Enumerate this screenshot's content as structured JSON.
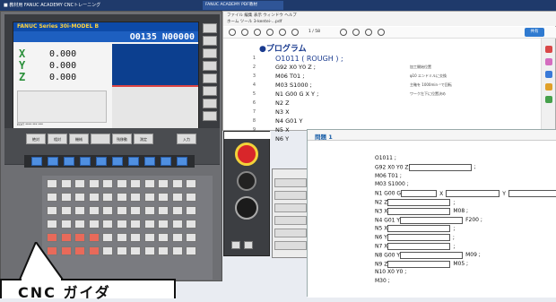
{
  "titlebar": {
    "text": "■ 教材用 FANUC ACADEMY  CNCトレーニング",
    "browser_tab": "FANUC ACADEMY PDF教材"
  },
  "cnc": {
    "brand": "FANUC Series 30i-MODEL B",
    "program_no": "O0135 N00000",
    "axes": [
      {
        "label": "X",
        "value": "0.000"
      },
      {
        "label": "Y",
        "value": "0.000"
      },
      {
        "label": "Z",
        "value": "0.000"
      }
    ],
    "softkeys": [
      "絶対",
      "相対",
      "機械",
      "",
      "残移動",
      "測定",
      "入力"
    ],
    "status": "EDIT **** *** ***"
  },
  "pdf": {
    "menu": "ファイル  編集  表示  ウィンドウ  ヘルプ",
    "tabs": "ホーム  ツール   3-kentei-...pdf",
    "page": "1 / 58",
    "share": "共有",
    "heading": "●プログラム",
    "lines": [
      {
        "n": "1",
        "code": "O1011 ( ROUGH ) ;",
        "note": ""
      },
      {
        "n": "2",
        "code": "G92 X0 Y0 Z          ;",
        "note": "加工開始位置"
      },
      {
        "n": "3",
        "code": "M06 T01 ;",
        "note": "φ10 エンドミルに交換"
      },
      {
        "n": "4",
        "code": "M03 S1000 ;",
        "note": "主軸を 1000min⁻¹で回転"
      },
      {
        "n": "5",
        "code": "N1  G00 G    X     Y     ;",
        "note": "ワーク左下に位置決め"
      },
      {
        "n": "6",
        "code": "N2  Z",
        "note": ""
      },
      {
        "n": "7",
        "code": "N3  X",
        "note": ""
      },
      {
        "n": "8",
        "code": "N4  G01 Y",
        "note": ""
      },
      {
        "n": "9",
        "code": "N5  X",
        "note": ""
      },
      {
        "n": "10",
        "code": "N6  Y",
        "note": ""
      }
    ]
  },
  "dialog": {
    "title": "問題 1",
    "lines": [
      {
        "text": "O1011 ;",
        "blanks": []
      },
      {
        "text": "G92 X0 Y0 Z",
        "blanks": [
          70
        ],
        "after": ";"
      },
      {
        "text": "M06 T01 ;",
        "blanks": []
      },
      {
        "text": "M03 S1000 ;",
        "blanks": []
      },
      {
        "text": "N1 G00 G",
        "blanks": [
          40
        ],
        "mid1": "X",
        "b2": 60,
        "mid2": "Y",
        "b3": 60,
        "after": ";"
      },
      {
        "text": "N2 Z",
        "blanks": [
          70
        ],
        "after": ";"
      },
      {
        "text": "N3 X",
        "blanks": [
          70
        ],
        "after": "M08 ;"
      },
      {
        "text": "N4 G01 Y",
        "blanks": [
          70
        ],
        "after": "F200 ;"
      },
      {
        "text": "N5 X",
        "blanks": [
          70
        ],
        "after": ";"
      },
      {
        "text": "N6 Y",
        "blanks": [
          70
        ],
        "after": ";"
      },
      {
        "text": "N7 X",
        "blanks": [
          70
        ],
        "after": ";"
      },
      {
        "text": "N8 G00 Y",
        "blanks": [
          70
        ],
        "after": "M09 ;"
      },
      {
        "text": "N9 Z",
        "blanks": [
          70
        ],
        "after": "M05 ;"
      },
      {
        "text": "N10 X0 Y0 ;",
        "blanks": []
      },
      {
        "text": "M30 ;",
        "blanks": []
      }
    ]
  },
  "callout": {
    "text": "CNC ガイダ"
  }
}
